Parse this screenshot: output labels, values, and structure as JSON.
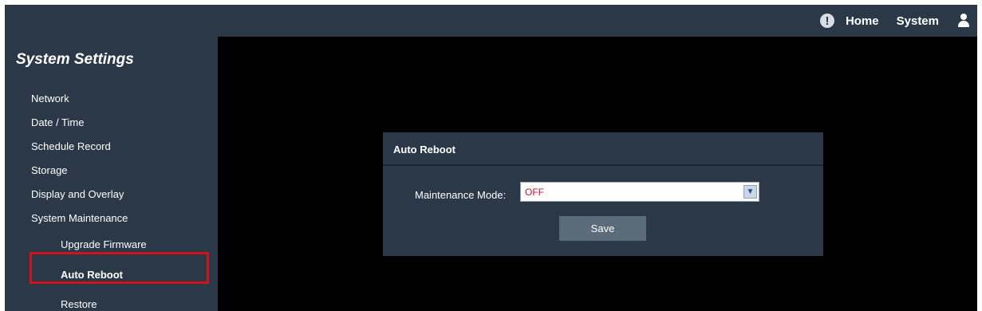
{
  "topbar": {
    "alert_icon": "exclamation-circle-icon",
    "home_label": "Home",
    "system_label": "System",
    "user_icon": "user-icon"
  },
  "sidebar": {
    "title": "System Settings",
    "items": [
      {
        "label": "Network"
      },
      {
        "label": "Date / Time"
      },
      {
        "label": "Schedule Record"
      },
      {
        "label": "Storage"
      },
      {
        "label": "Display and Overlay"
      },
      {
        "label": "System Maintenance"
      }
    ],
    "subitems": [
      {
        "label": "Upgrade Firmware"
      },
      {
        "label": "Auto Reboot",
        "active": true
      },
      {
        "label": "Restore"
      }
    ]
  },
  "panel": {
    "title": "Auto Reboot",
    "maintenance_mode_label": "Maintenance Mode:",
    "maintenance_mode_value": "OFF",
    "save_label": "Save"
  },
  "colors": {
    "background": "#000000",
    "panel": "#2a3847",
    "highlight": "#d0121b",
    "select_value": "#c8102e"
  }
}
